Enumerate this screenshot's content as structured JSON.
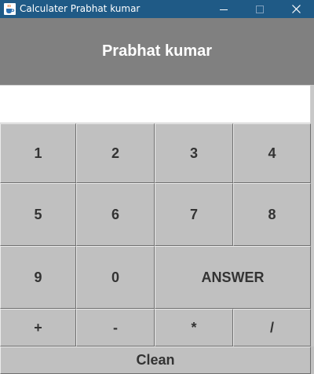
{
  "window": {
    "title": "Calculater Prabhat kumar",
    "icon": "java-coffee-cup-icon",
    "controls": [
      "minimize-icon",
      "maximize-icon",
      "close-icon"
    ]
  },
  "header": {
    "title": "Prabhat kumar"
  },
  "display": {
    "value": ""
  },
  "keys": {
    "k1": "1",
    "k2": "2",
    "k3": "3",
    "k4": "4",
    "k5": "5",
    "k6": "6",
    "k7": "7",
    "k8": "8",
    "k9": "9",
    "k0": "0",
    "answer": "ANSWER",
    "plus": "+",
    "minus": "-",
    "multiply": "*",
    "divide": "/",
    "clean": "Clean"
  },
  "colors": {
    "titlebar": "#1f5a86",
    "header_bg": "#808080",
    "key_bg": "#c0c0c0",
    "key_text": "#333333"
  }
}
